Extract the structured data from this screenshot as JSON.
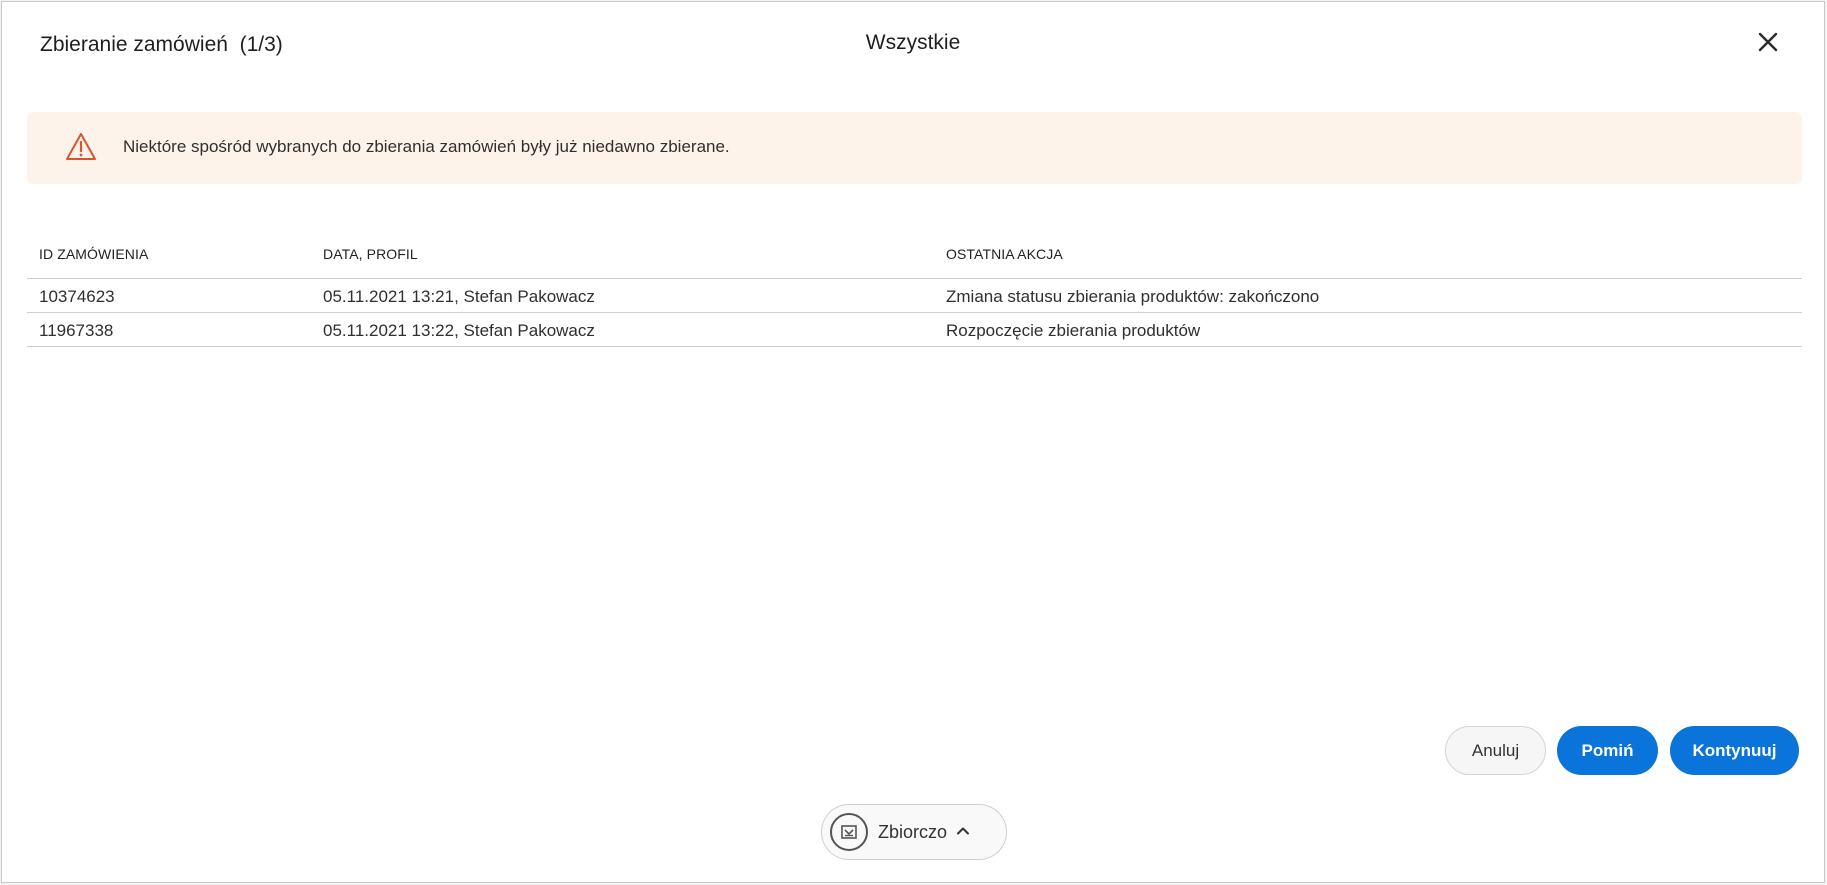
{
  "dialog": {
    "title": "Zbieranie zamówień  (1/3)",
    "filter_label": "Wszystkie"
  },
  "alert": {
    "message": "Niektóre spośród wybranych do zbierania zamówień były już niedawno zbierane.",
    "icon": "warning-triangle-icon",
    "color": "#d9542f"
  },
  "table": {
    "headers": [
      "ID ZAMÓWIENIA",
      "DATA, PROFIL",
      "OSTATNIA AKCJA"
    ],
    "rows": [
      [
        "10374623",
        "05.11.2021 13:21, Stefan Pakowacz",
        "Zmiana statusu zbierania produktów: zakończono"
      ],
      [
        "11967338",
        "05.11.2021 13:22, Stefan Pakowacz",
        "Rozpoczęcie zbierania produktów"
      ]
    ]
  },
  "buttons": {
    "cancel": "Anuluj",
    "skip": "Pomiń",
    "continue": "Kontynuuj",
    "primary_color": "#0a74da"
  },
  "summary_toggle": {
    "label": "Zbiorczo",
    "icon": "bulk-view-icon",
    "chevron": "chevron-up-icon"
  }
}
